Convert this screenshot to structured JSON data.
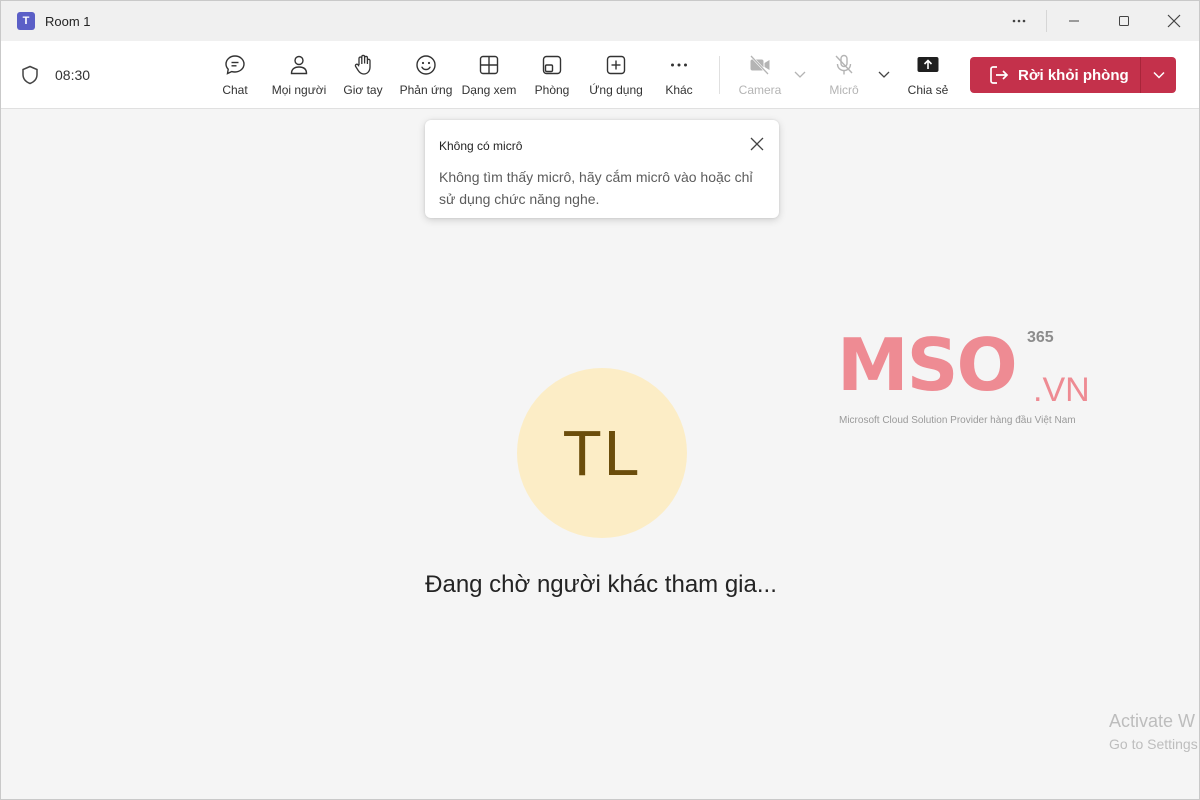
{
  "window": {
    "title": "Room 1",
    "app_logo_text": "T"
  },
  "toolbar": {
    "timer": "08:30",
    "items": [
      {
        "label": "Chat",
        "icon": "chat-icon"
      },
      {
        "label": "Mọi người",
        "icon": "people-icon"
      },
      {
        "label": "Giơ tay",
        "icon": "raise-hand-icon"
      },
      {
        "label": "Phản ứng",
        "icon": "emoji-icon"
      },
      {
        "label": "Dạng xem",
        "icon": "grid-view-icon"
      },
      {
        "label": "Phòng",
        "icon": "rooms-icon"
      },
      {
        "label": "Ứng dụng",
        "icon": "add-app-icon"
      },
      {
        "label": "Khác",
        "icon": "more-icon"
      },
      {
        "label": "Camera",
        "icon": "camera-off-icon",
        "disabled": true
      },
      {
        "label": "Micrô",
        "icon": "mic-off-icon",
        "disabled": true
      },
      {
        "label": "Chia sẻ",
        "icon": "share-icon"
      }
    ],
    "leave_label": "Rời khỏi phòng",
    "leave_color": "#c4314b"
  },
  "tooltip": {
    "title": "Không có micrô",
    "body": "Không tìm thấy micrô, hãy cắm micrô vào hoặc chỉ sử dụng chức năng nghe."
  },
  "stage": {
    "avatar_initials": "TL",
    "avatar_bg": "#fcedc6",
    "waiting_text": "Đang chờ người khác tham gia..."
  },
  "watermark": {
    "brand": "MSO",
    "brand_suffix": ".VN",
    "brand_super": "365",
    "tagline": "Microsoft Cloud Solution Provider hàng đầu Việt Nam",
    "color": "#ee8b93"
  },
  "os_notice": {
    "title": "Activate W",
    "subtitle": "Go to Settings"
  }
}
